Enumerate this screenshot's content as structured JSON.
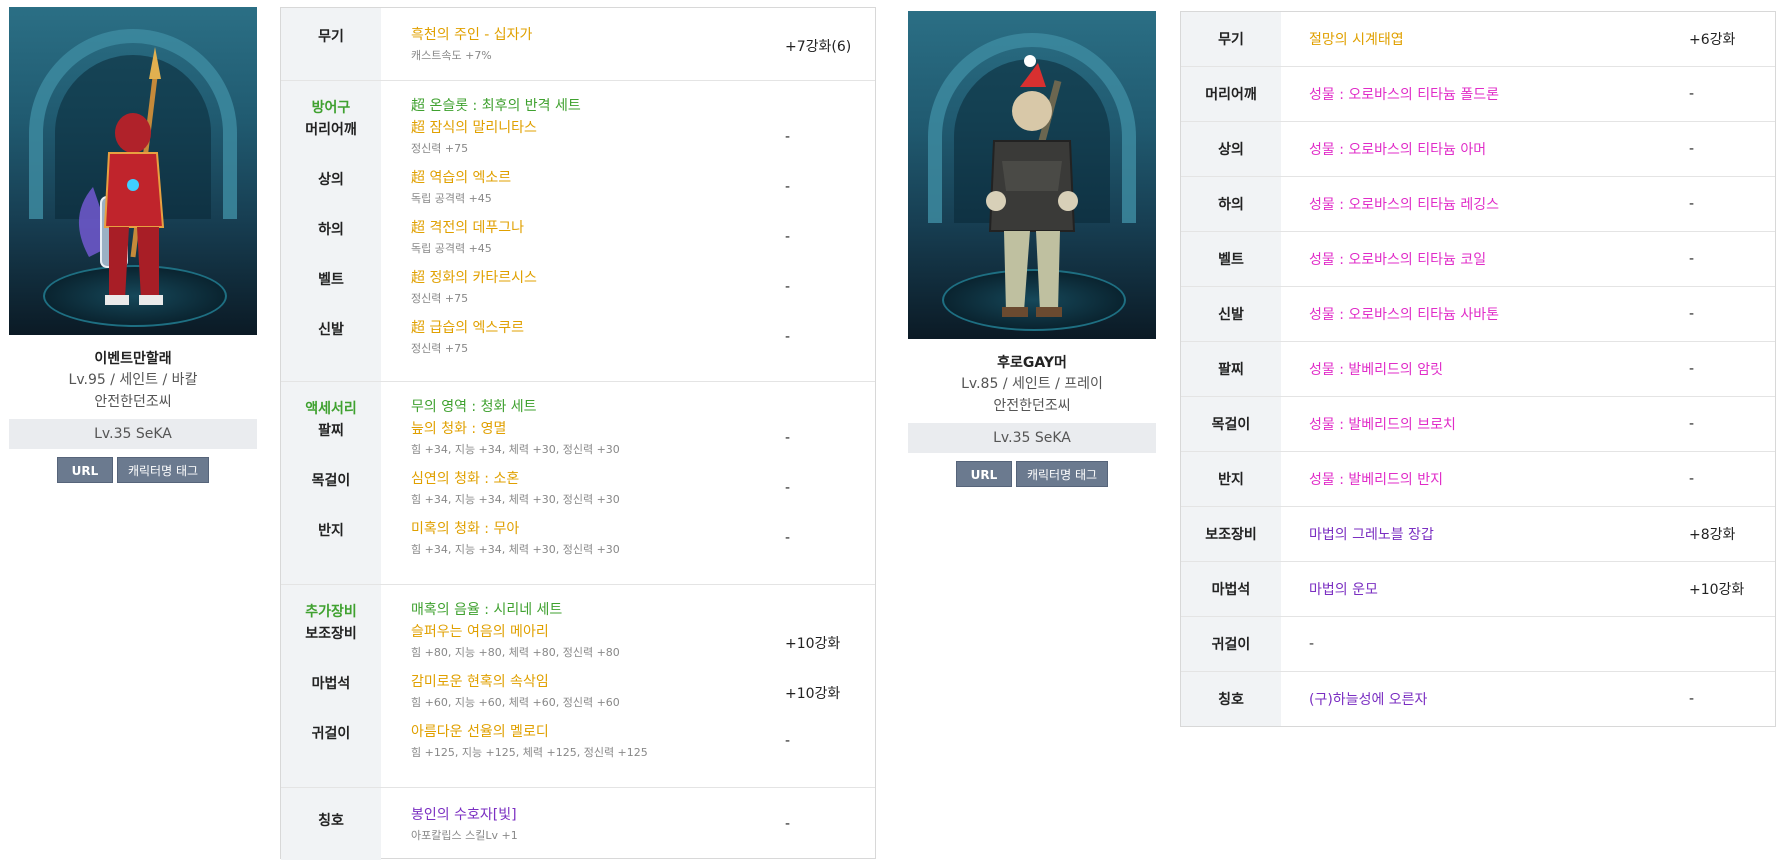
{
  "char1": {
    "name": "이벤트만할래",
    "info": "Lv.95 / 세인트 / 바칼",
    "guild": "안전한던조씨",
    "adventure": "Lv.35 SeKA",
    "url_label": "URL",
    "tag_label": "캐릭터명 태그"
  },
  "char2": {
    "name": "후로GAY머",
    "info": "Lv.85 / 세인트 / 프레이",
    "guild": "안전한던조씨",
    "adventure": "Lv.35 SeKA",
    "url_label": "URL",
    "tag_label": "캐릭터명 태그"
  },
  "table1": {
    "weapon": {
      "slot": "무기",
      "name": "흑천의 주인 - 십자가",
      "sub": "캐스트속도 +7%",
      "up": "+7강화(6)"
    },
    "armor": {
      "group": "방어구",
      "set": "超 온슬롯 : 최후의 반격 세트",
      "items": [
        {
          "slot": "머리어깨",
          "name": "超 잠식의 말리니타스",
          "sub": "정신력 +75",
          "up": "-"
        },
        {
          "slot": "상의",
          "name": "超 역습의 엑소르",
          "sub": "독립 공격력 +45",
          "up": "-"
        },
        {
          "slot": "하의",
          "name": "超 격전의 데푸그나",
          "sub": "독립 공격력 +45",
          "up": "-"
        },
        {
          "slot": "벨트",
          "name": "超 정화의 카타르시스",
          "sub": "정신력 +75",
          "up": "-"
        },
        {
          "slot": "신발",
          "name": "超 급습의 엑스쿠르",
          "sub": "정신력 +75",
          "up": "-"
        }
      ]
    },
    "accessory": {
      "group": "액세서리",
      "set": "무의 영역 : 청화 세트",
      "items": [
        {
          "slot": "팔찌",
          "name": "늪의 청화 : 영멸",
          "sub": "힘 +34, 지능 +34, 체력 +30, 정신력 +30",
          "up": "-"
        },
        {
          "slot": "목걸이",
          "name": "심연의 청화 : 소혼",
          "sub": "힘 +34, 지능 +34, 체력 +30, 정신력 +30",
          "up": "-"
        },
        {
          "slot": "반지",
          "name": "미혹의 청화 : 무아",
          "sub": "힘 +34, 지능 +34, 체력 +30, 정신력 +30",
          "up": "-"
        }
      ]
    },
    "extra": {
      "group": "추가장비",
      "set": "매혹의 음율 : 시리네 세트",
      "items": [
        {
          "slot": "보조장비",
          "name": "슬퍼우는 여음의 메아리",
          "sub": "힘 +80, 지능 +80, 체력 +80, 정신력 +80",
          "up": "+10강화"
        },
        {
          "slot": "마법석",
          "name": "감미로운 현혹의 속삭임",
          "sub": "힘 +60, 지능 +60, 체력 +60, 정신력 +60",
          "up": "+10강화"
        },
        {
          "slot": "귀걸이",
          "name": "아름다운 선율의 멜로디",
          "sub": "힘 +125, 지능 +125, 체력 +125, 정신력 +125",
          "up": "-"
        }
      ]
    },
    "title": {
      "slot": "칭호",
      "name": "봉인의 수호자[빛]",
      "sub": "아포칼립스 스킬Lv +1",
      "up": "-"
    }
  },
  "table2": {
    "rows": [
      {
        "slot": "무기",
        "name": "절망의 시계태엽",
        "up": "+6강화",
        "color": "orange"
      },
      {
        "slot": "머리어깨",
        "name": "성물 : 오로바스의 티타늄 폴드론",
        "up": "-",
        "color": "pink"
      },
      {
        "slot": "상의",
        "name": "성물 : 오로바스의 티타늄 아머",
        "up": "-",
        "color": "pink"
      },
      {
        "slot": "하의",
        "name": "성물 : 오로바스의 티타늄 레깅스",
        "up": "-",
        "color": "pink"
      },
      {
        "slot": "벨트",
        "name": "성물 : 오로바스의 티타늄 코일",
        "up": "-",
        "color": "pink"
      },
      {
        "slot": "신발",
        "name": "성물 : 오로바스의 티타늄 사바톤",
        "up": "-",
        "color": "pink"
      },
      {
        "slot": "팔찌",
        "name": "성물 : 발베리드의 암릿",
        "up": "-",
        "color": "pink"
      },
      {
        "slot": "목걸이",
        "name": "성물 : 발베리드의 브로치",
        "up": "-",
        "color": "pink"
      },
      {
        "slot": "반지",
        "name": "성물 : 발베리드의 반지",
        "up": "-",
        "color": "pink"
      },
      {
        "slot": "보조장비",
        "name": "마법의 그레노블 장갑",
        "up": "+8강화",
        "color": "purple"
      },
      {
        "slot": "마법석",
        "name": "마법의 운모",
        "up": "+10강화",
        "color": "purple"
      },
      {
        "slot": "귀걸이",
        "name": "-",
        "up": "",
        "color": "dark"
      },
      {
        "slot": "칭호",
        "name": "(구)하늘성에 오른자",
        "up": "-",
        "color": "purple"
      }
    ]
  }
}
